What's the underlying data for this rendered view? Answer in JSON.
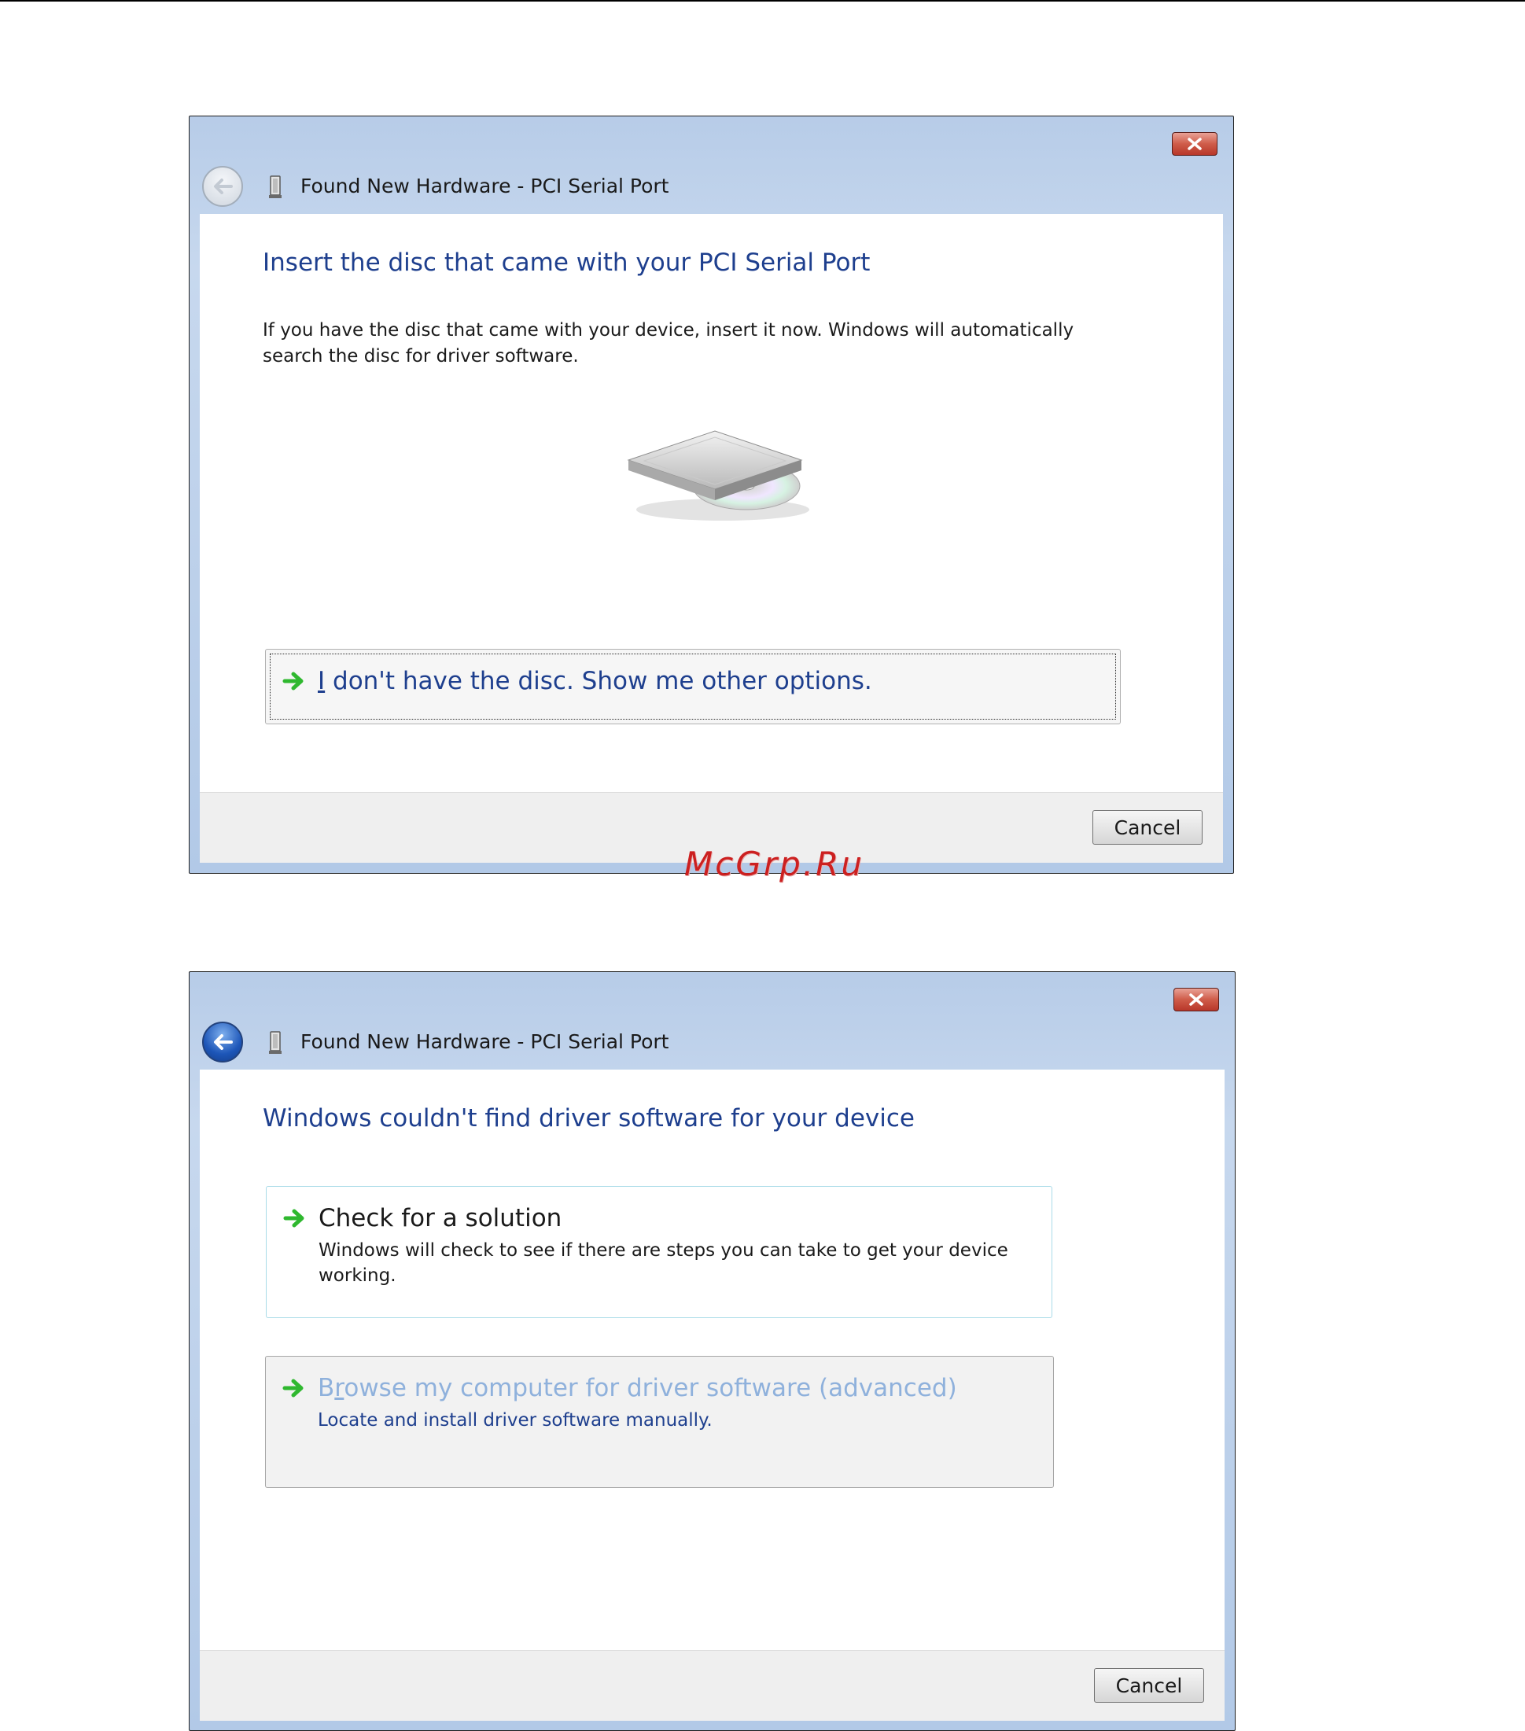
{
  "watermark": "McGrp.Ru",
  "dialog1": {
    "title": "Found New Hardware - PCI Serial Port",
    "heading": "Insert the disc that came with your PCI Serial Port",
    "description": "If you have the disc that came with your device, insert it now.  Windows will automatically search the disc for driver software.",
    "option_nodisc": {
      "mnemonic": "I",
      "label_rest": " don't have the disc.  Show me other options."
    },
    "cancel_label": "Cancel",
    "back_enabled": false
  },
  "dialog2": {
    "title": "Found New Hardware - PCI Serial Port",
    "heading": "Windows couldn't find driver software for your device",
    "option_solution": {
      "label": "Check for a solution",
      "description": "Windows will check to see if there are steps you can take to get your device working."
    },
    "option_browse": {
      "label_pre": "B",
      "mnemonic": "r",
      "label_rest": "owse my computer for driver software (advanced)",
      "description": "Locate and install driver software manually."
    },
    "cancel_label": "Cancel",
    "back_enabled": true
  },
  "icons": {
    "back": "back-arrow-icon",
    "device": "serial-port-device-icon",
    "close": "close-icon",
    "option_arrow": "green-arrow-icon",
    "disc_drive": "optical-drive-icon"
  },
  "colors": {
    "heading": "#1e3f8e",
    "arrow": "#2fb82f",
    "close": "#cf5c49",
    "disabled_link": "#8fb1dc"
  }
}
